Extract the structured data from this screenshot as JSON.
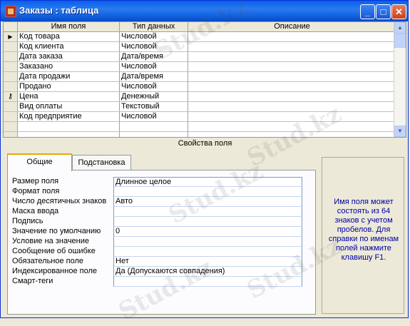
{
  "window": {
    "title": "Заказы : таблица",
    "controls": {
      "minimize": "_",
      "maximize": "□",
      "close": "✕"
    }
  },
  "grid": {
    "columns": [
      "Имя поля",
      "Тип данных",
      "Описание"
    ],
    "rows": [
      {
        "name": "Код товара",
        "type": "Числовой",
        "desc": "",
        "marker": "current"
      },
      {
        "name": "Код клиента",
        "type": "Числовой",
        "desc": "",
        "marker": ""
      },
      {
        "name": "Дата заказа",
        "type": "Дата/время",
        "desc": "",
        "marker": ""
      },
      {
        "name": "Заказано",
        "type": "Числовой",
        "desc": "",
        "marker": ""
      },
      {
        "name": "Дата продажи",
        "type": "Дата/время",
        "desc": "",
        "marker": ""
      },
      {
        "name": "Продано",
        "type": "Числовой",
        "desc": "",
        "marker": ""
      },
      {
        "name": "Цена",
        "type": "Денежный",
        "desc": "",
        "marker": "key"
      },
      {
        "name": "Вид оплаты",
        "type": "Текстовый",
        "desc": "",
        "marker": ""
      },
      {
        "name": "Код предприятие",
        "type": "Числовой",
        "desc": "",
        "marker": ""
      },
      {
        "name": "",
        "type": "",
        "desc": "",
        "marker": ""
      },
      {
        "name": "",
        "type": "",
        "desc": "",
        "marker": ""
      }
    ]
  },
  "properties": {
    "header": "Свойства поля",
    "tabs": [
      "Общие",
      "Подстановка"
    ],
    "active_tab": "Общие",
    "rows": [
      {
        "label": "Размер поля",
        "value": "Длинное целое"
      },
      {
        "label": "Формат поля",
        "value": ""
      },
      {
        "label": "Число десятичных знаков",
        "value": "Авто"
      },
      {
        "label": "Маска ввода",
        "value": ""
      },
      {
        "label": "Подпись",
        "value": ""
      },
      {
        "label": "Значение по умолчанию",
        "value": "0"
      },
      {
        "label": "Условие на значение",
        "value": ""
      },
      {
        "label": "Сообщение об ошибке",
        "value": ""
      },
      {
        "label": "Обязательное поле",
        "value": "Нет"
      },
      {
        "label": "Индексированное поле",
        "value": "Да (Допускаются совпадения)"
      },
      {
        "label": "Смарт-теги",
        "value": ""
      }
    ],
    "help_text": "Имя поля может состоять из 64 знаков с учетом пробелов.  Для справки по именам полей нажмите клавишу F1."
  },
  "watermark": "Stud.kz",
  "colors": {
    "title_bar": "#0a5fe8",
    "help_text": "#0000a0",
    "tab_accent": "#e8a800"
  }
}
